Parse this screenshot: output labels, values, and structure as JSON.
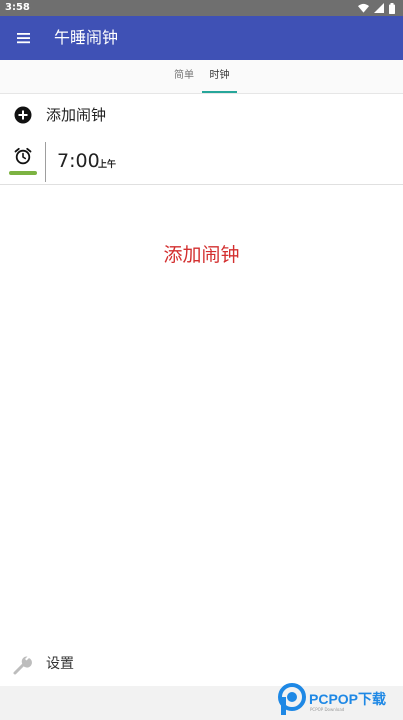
{
  "status_bar": {
    "time": "3:58"
  },
  "app_bar": {
    "title": "午睡闹钟"
  },
  "tabs": [
    {
      "label": "简单",
      "active": false
    },
    {
      "label": "时钟",
      "active": true
    }
  ],
  "add_alarm": {
    "label": "添加闹钟"
  },
  "alarms": [
    {
      "time": "7:00",
      "period": "上午",
      "enabled": true
    }
  ],
  "empty_prompt": "添加闹钟",
  "settings": {
    "label": "设置"
  },
  "watermark": {
    "brand": "PCPOP",
    "suffix": "下载",
    "sub": "PCPOP Download"
  },
  "colors": {
    "app_bar": "#3f51b5",
    "tab_indicator": "#26a69a",
    "toggle_on": "#7cb342",
    "prompt": "#d32f2f"
  }
}
